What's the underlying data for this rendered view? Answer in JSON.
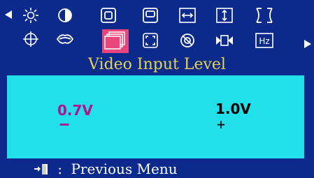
{
  "menu": {
    "row1_icons": [
      "brightness-icon",
      "contrast-icon",
      "position-icon",
      "size-icon",
      "horizontal-icon",
      "vertical-icon",
      "pincushion-icon"
    ],
    "row2_icons": [
      "rotation-icon",
      "parallelogram-icon",
      "video-input-level-icon",
      "moire-icon",
      "degauss-icon",
      "trapezoid-icon",
      "hz-icon"
    ],
    "hz_label": "Hz",
    "selected_item": "video-input-level-icon",
    "selected_color": "#e8467a"
  },
  "title": "Video Input Level",
  "options": {
    "left_value": "0.7V",
    "left_symbol": "−",
    "right_value": "1.0V",
    "right_symbol": "+"
  },
  "footer": {
    "icon": "exit-door-icon",
    "text": "Previous Menu",
    "separator": ":"
  },
  "colors": {
    "background": "#0b2a8c",
    "panel": "#22e0ea",
    "title": "#e6d250",
    "selected_value": "#b0158c"
  }
}
